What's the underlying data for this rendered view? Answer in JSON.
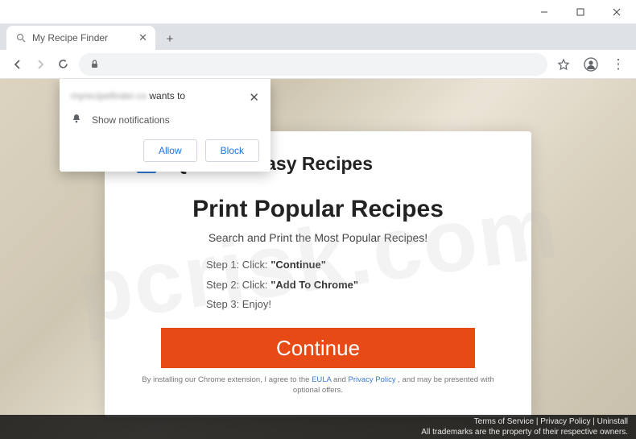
{
  "window": {
    "minimize": "—",
    "maximize": "☐",
    "close": "✕"
  },
  "tab": {
    "title": "My Recipe Finder",
    "close": "✕",
    "new": "+"
  },
  "nav": {
    "back": "←",
    "forward": "→",
    "reload": "⟳",
    "star": "☆",
    "account": "◯",
    "menu": "⋮"
  },
  "permission": {
    "domain": "myrecipefinder.co",
    "wants": " wants to",
    "item": "Show notifications",
    "allow": "Allow",
    "block": "Block",
    "close": "✕"
  },
  "brand": "Quick 'N Easy Recipes",
  "headline": "Print Popular Recipes",
  "subhead": "Search and Print the Most Popular Recipes!",
  "steps": {
    "s1a": "Step 1: Click: ",
    "s1b": "\"Continue\"",
    "s2a": "Step 2: Click: ",
    "s2b": "\"Add To Chrome\"",
    "s3": "Step 3: Enjoy!"
  },
  "cta": "Continue",
  "disclaimer": {
    "pre": "By installing our Chrome extension, I agree to the ",
    "eula": "EULA",
    "and": " and ",
    "pp": "Privacy Policy",
    "post": " , and may be presented with optional offers."
  },
  "footer": {
    "links": "Terms of Service | Privacy Policy | Uninstall",
    "tm": "All trademarks are the property of their respective owners."
  },
  "watermark": "pcrisk.com"
}
